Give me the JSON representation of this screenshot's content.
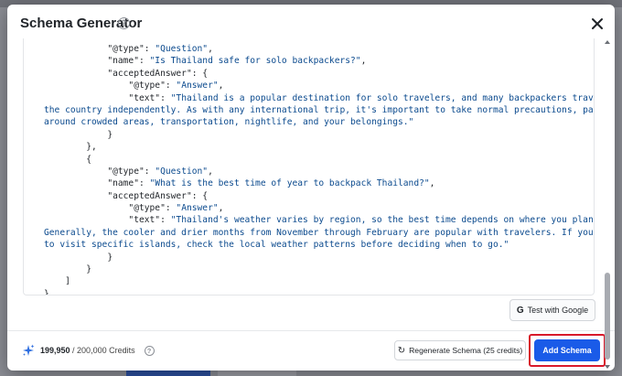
{
  "modal": {
    "title": "Schema Generator",
    "help_icon": "question-circle-icon",
    "close_icon": "close-x-icon"
  },
  "code": {
    "lines": [
      {
        "indent": "            ",
        "key": "\"@type\"",
        "sep": ": ",
        "value": "\"Question\"",
        "tail": ","
      },
      {
        "indent": "            ",
        "key": "\"name\"",
        "sep": ": ",
        "value": "\"Is Thailand safe for solo backpackers?\"",
        "tail": ","
      },
      {
        "indent": "            ",
        "key": "\"acceptedAnswer\"",
        "sep": ": ",
        "value": "",
        "tail": "{"
      },
      {
        "indent": "                ",
        "key": "\"@type\"",
        "sep": ": ",
        "value": "\"Answer\"",
        "tail": ","
      },
      {
        "indent": "                ",
        "key": "\"text\"",
        "sep": ": ",
        "value": "\"Thailand is a popular destination for solo travelers, and many backpackers travel around",
        "tail": ""
      },
      {
        "indent": "",
        "key": "",
        "sep": "",
        "value": "the country independently. As with any international trip, it's important to take normal precautions, particularly",
        "tail": ""
      },
      {
        "indent": "",
        "key": "",
        "sep": "",
        "value": "around crowded areas, transportation, nightlife, and your belongings.\"",
        "tail": ""
      },
      {
        "indent": "            ",
        "key": "",
        "sep": "",
        "value": "",
        "tail": "}"
      },
      {
        "indent": "        ",
        "key": "",
        "sep": "",
        "value": "",
        "tail": "},"
      },
      {
        "indent": "        ",
        "key": "",
        "sep": "",
        "value": "",
        "tail": "{"
      },
      {
        "indent": "            ",
        "key": "\"@type\"",
        "sep": ": ",
        "value": "\"Question\"",
        "tail": ","
      },
      {
        "indent": "            ",
        "key": "\"name\"",
        "sep": ": ",
        "value": "\"What is the best time of year to backpack Thailand?\"",
        "tail": ","
      },
      {
        "indent": "            ",
        "key": "\"acceptedAnswer\"",
        "sep": ": ",
        "value": "",
        "tail": "{"
      },
      {
        "indent": "                ",
        "key": "\"@type\"",
        "sep": ": ",
        "value": "\"Answer\"",
        "tail": ","
      },
      {
        "indent": "                ",
        "key": "\"text\"",
        "sep": ": ",
        "value": "\"Thailand's weather varies by region, so the best time depends on where you plan to travel.",
        "tail": ""
      },
      {
        "indent": "",
        "key": "",
        "sep": "",
        "value": "Generally, the cooler and drier months from November through February are popular with travelers. If you're planning",
        "tail": ""
      },
      {
        "indent": "",
        "key": "",
        "sep": "",
        "value": "to visit specific islands, check the local weather patterns before deciding when to go.\"",
        "tail": ""
      },
      {
        "indent": "            ",
        "key": "",
        "sep": "",
        "value": "",
        "tail": "}"
      },
      {
        "indent": "        ",
        "key": "",
        "sep": "",
        "value": "",
        "tail": "}"
      },
      {
        "indent": "    ",
        "key": "",
        "sep": "",
        "value": "",
        "tail": "]"
      },
      {
        "indent": "",
        "key": "",
        "sep": "",
        "value": "",
        "tail": "}"
      }
    ]
  },
  "test_button": {
    "label": "Test with Google",
    "icon": "google-g-icon"
  },
  "footer": {
    "credits_used": "199,950",
    "credits_total": " / 200,000 Credits",
    "sparkle_icon": "sparkle-icon"
  },
  "regenerate_button": {
    "label": "Regenerate Schema (25 credits)",
    "icon": "refresh-icon"
  },
  "add_button": {
    "label": "Add Schema"
  },
  "colors": {
    "accent": "#1a5be8",
    "highlight": "#d8192b",
    "code_string": "#0b4a8e"
  }
}
